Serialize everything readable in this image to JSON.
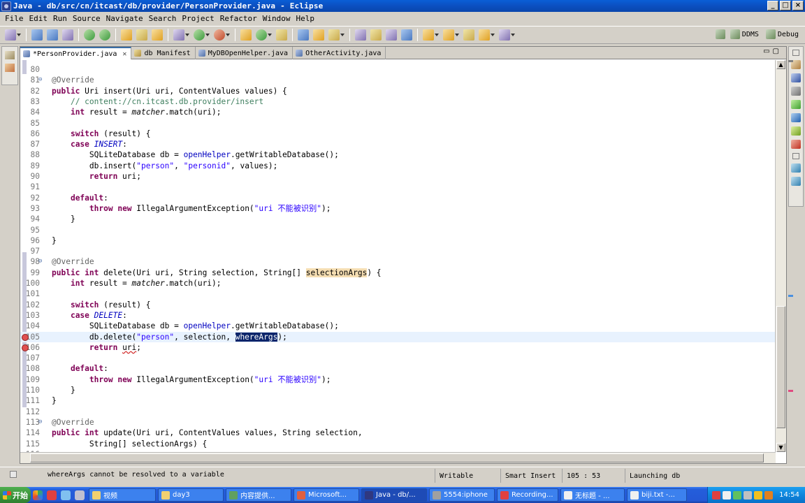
{
  "window": {
    "title": "Java - db/src/cn/itcast/db/provider/PersonProvider.java - Eclipse"
  },
  "menu": [
    "File",
    "Edit",
    "Run",
    "Source",
    "Navigate",
    "Search",
    "Project",
    "Refactor",
    "Window",
    "Help"
  ],
  "perspectives": [
    "DDMS",
    "Debug"
  ],
  "tabs": [
    {
      "label": "*PersonProvider.java",
      "active": true,
      "close": "✕"
    },
    {
      "label": "db Manifest"
    },
    {
      "label": "MyDBOpenHelper.java"
    },
    {
      "label": "OtherActivity.java"
    }
  ],
  "code_lines": [
    {
      "n": "80",
      "html": ""
    },
    {
      "n": "81",
      "html": "<span class=\"an\">@Override</span>"
    },
    {
      "n": "82",
      "html": "<span class=\"kw\">public</span> Uri insert(Uri uri, ContentValues values) {"
    },
    {
      "n": "83",
      "html": "    <span class=\"cm\">// content://cn.itcast.db.provider/insert</span>"
    },
    {
      "n": "84",
      "html": "    <span class=\"kw\">int</span> result = <span class=\"it\">matcher</span>.match(uri);"
    },
    {
      "n": "85",
      "html": ""
    },
    {
      "n": "86",
      "html": "    <span class=\"kw\">switch</span> (result) {"
    },
    {
      "n": "87",
      "html": "    <span class=\"kw\">case</span> <span class=\"fi\">INSERT</span>:"
    },
    {
      "n": "88",
      "html": "        SQLiteDatabase db = <span class=\"fl\">openHelper</span>.getWritableDatabase();"
    },
    {
      "n": "89",
      "html": "        db.insert(<span class=\"st\">\"person\"</span>, <span class=\"st\">\"personid\"</span>, values);"
    },
    {
      "n": "90",
      "html": "        <span class=\"kw\">return</span> uri;"
    },
    {
      "n": "91",
      "html": ""
    },
    {
      "n": "92",
      "html": "    <span class=\"kw\">default</span>:"
    },
    {
      "n": "93",
      "html": "        <span class=\"kw\">throw</span> <span class=\"kw\">new</span> IllegalArgumentException(<span class=\"st\">\"uri 不能被识别\"</span>);"
    },
    {
      "n": "94",
      "html": "    }"
    },
    {
      "n": "95",
      "html": ""
    },
    {
      "n": "96",
      "html": "}"
    },
    {
      "n": "97",
      "html": ""
    },
    {
      "n": "98",
      "html": "<span class=\"an\">@Override</span>"
    },
    {
      "n": "99",
      "html": "<span class=\"kw\">public</span> <span class=\"kw\">int</span> delete(Uri uri, String selection, String[] <span class=\"occ\">selectionArgs</span>) {"
    },
    {
      "n": "100",
      "html": "    <span class=\"kw\">int</span> result = <span class=\"it\">matcher</span>.match(uri);"
    },
    {
      "n": "101",
      "html": ""
    },
    {
      "n": "102",
      "html": "    <span class=\"kw\">switch</span> (result) {"
    },
    {
      "n": "103",
      "html": "    <span class=\"kw\">case</span> <span class=\"fi\">DELETE</span>:"
    },
    {
      "n": "104",
      "html": "        SQLiteDatabase db = <span class=\"fl\">openHelper</span>.getWritableDatabase();"
    },
    {
      "n": "105",
      "html": "        db.delete(<span class=\"st\">\"person\"</span>, selection, <span class=\"sel\">whereArgs</span>);"
    },
    {
      "n": "106",
      "html": "        <span class=\"kw\">return</span> <span class=\"squig\">uri</span>;"
    },
    {
      "n": "107",
      "html": ""
    },
    {
      "n": "108",
      "html": "    <span class=\"kw\">default</span>:"
    },
    {
      "n": "109",
      "html": "        <span class=\"kw\">throw</span> <span class=\"kw\">new</span> IllegalArgumentException(<span class=\"st\">\"uri 不能被识别\"</span>);"
    },
    {
      "n": "110",
      "html": "    }"
    },
    {
      "n": "111",
      "html": "}"
    },
    {
      "n": "112",
      "html": ""
    },
    {
      "n": "113",
      "html": "<span class=\"an\">@Override</span>"
    },
    {
      "n": "114",
      "html": "<span class=\"kw\">public</span> <span class=\"kw\">int</span> update(Uri uri, ContentValues values, String selection,"
    },
    {
      "n": "115",
      "html": "        String[] selectionArgs) {"
    },
    {
      "n": "116",
      "html": ""
    }
  ],
  "current_line": "105",
  "error_lines": [
    "105",
    "106"
  ],
  "fold_lines": [
    "81",
    "98",
    "113"
  ],
  "status": {
    "message": "whereArgs cannot be resolved to a variable",
    "writable": "Writable",
    "insert_mode": "Smart Insert",
    "position": "105 : 53",
    "progress": "Launching db"
  },
  "taskbar": {
    "start": "开始",
    "tasks": [
      {
        "label": "视频"
      },
      {
        "label": "day3"
      },
      {
        "label": "内容提供..."
      },
      {
        "label": "Microsoft..."
      },
      {
        "label": "Java - db/...",
        "active": true
      },
      {
        "label": "5554:iphone"
      },
      {
        "label": "Recording..."
      },
      {
        "label": "无标题 - ..."
      },
      {
        "label": "biji.txt -..."
      }
    ],
    "clock": "14:54"
  }
}
